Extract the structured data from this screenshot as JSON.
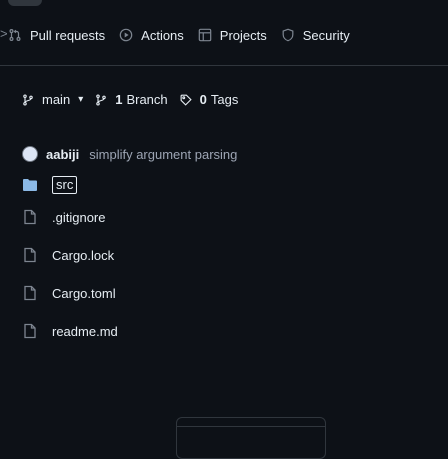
{
  "nav": {
    "edge": ">",
    "tabs": [
      {
        "label": "Pull requests",
        "icon": "pull-request-icon"
      },
      {
        "label": "Actions",
        "icon": "play-icon"
      },
      {
        "label": "Projects",
        "icon": "table-icon"
      },
      {
        "label": "Security",
        "icon": "shield-icon"
      }
    ]
  },
  "branchbar": {
    "branch": "main",
    "branch_count": "1",
    "branch_label": "Branch",
    "tag_count": "0",
    "tag_label": "Tags"
  },
  "commit": {
    "author": "aabiji",
    "message": "simplify argument parsing"
  },
  "files": [
    {
      "name": "src",
      "type": "folder"
    },
    {
      "name": ".gitignore",
      "type": "file"
    },
    {
      "name": "Cargo.lock",
      "type": "file"
    },
    {
      "name": "Cargo.toml",
      "type": "file"
    },
    {
      "name": "readme.md",
      "type": "file"
    }
  ]
}
